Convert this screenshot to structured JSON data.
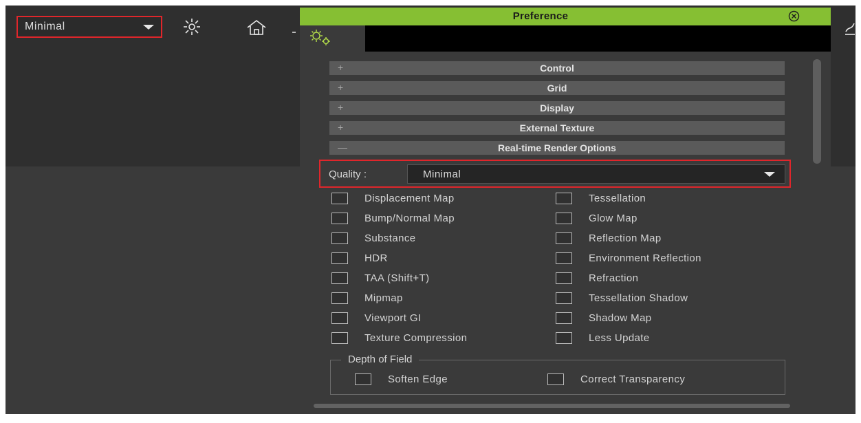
{
  "toolbar": {
    "quality_value": "Minimal",
    "icons": [
      "sun-icon",
      "home-icon",
      "chevron-down-icon",
      "curve-tool-icon"
    ]
  },
  "preference": {
    "title": "Preference",
    "tab_icon": "gears-icon",
    "close_icon": "close-circle-icon",
    "sections": [
      {
        "symbol": "+",
        "label": "Control"
      },
      {
        "symbol": "+",
        "label": "Grid"
      },
      {
        "symbol": "+",
        "label": "Display"
      },
      {
        "symbol": "+",
        "label": "External Texture"
      },
      {
        "symbol": "—",
        "label": "Real-time Render Options"
      }
    ],
    "quality": {
      "label": "Quality :",
      "value": "Minimal"
    },
    "options_left": [
      {
        "label": "Displacement Map",
        "checked": false
      },
      {
        "label": "Bump/Normal Map",
        "checked": false
      },
      {
        "label": "Substance",
        "checked": false
      },
      {
        "label": "HDR",
        "checked": false
      },
      {
        "label": "TAA (Shift+T)",
        "checked": false
      },
      {
        "label": "Mipmap",
        "checked": false
      },
      {
        "label": "Viewport GI",
        "checked": false
      },
      {
        "label": "Texture Compression",
        "checked": false
      }
    ],
    "options_right": [
      {
        "label": "Tessellation",
        "checked": false
      },
      {
        "label": "Glow Map",
        "checked": false
      },
      {
        "label": "Reflection Map",
        "checked": false
      },
      {
        "label": "Environment Reflection",
        "checked": false
      },
      {
        "label": "Refraction",
        "checked": false
      },
      {
        "label": "Tessellation Shadow",
        "checked": false
      },
      {
        "label": "Shadow Map",
        "checked": false
      },
      {
        "label": "Less Update",
        "checked": false
      }
    ],
    "depth_of_field": {
      "legend": "Depth of Field",
      "options": [
        {
          "label": "Soften Edge",
          "checked": false
        },
        {
          "label": "Correct Transparency",
          "checked": false
        }
      ]
    }
  },
  "colors": {
    "title_bar": "#86bf33",
    "highlight": "#e0262b",
    "panel": "#3a3a3a",
    "section_header": "#5a5a5a"
  }
}
